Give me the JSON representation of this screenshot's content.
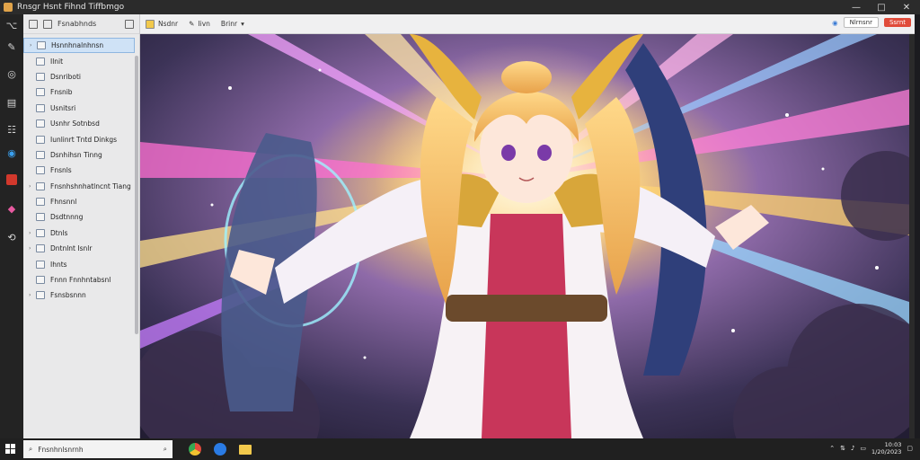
{
  "window": {
    "title": "Rnsgr Hsnt Fihnd Tiffbmgo",
    "controls": {
      "minimize": "—",
      "maximize": "□",
      "close": "✕"
    }
  },
  "rail": {
    "icons": [
      "code-icon",
      "pin-icon",
      "lens-icon",
      "doc-icon",
      "list-icon",
      "edge-icon",
      "app-red-icon",
      "paint-icon",
      "sync-icon"
    ]
  },
  "sidebar": {
    "toolbar_label": "Fsnabhnds",
    "items": [
      {
        "label": "Hsnnhnalnhnsn",
        "selected": true,
        "expandable": true
      },
      {
        "label": "Ilnit",
        "selected": false,
        "expandable": false
      },
      {
        "label": "Dsnriboti",
        "selected": false,
        "expandable": false
      },
      {
        "label": "Fnsnib",
        "selected": false,
        "expandable": false
      },
      {
        "label": "Usnitsri",
        "selected": false,
        "expandable": false
      },
      {
        "label": "Usnhr Sotnbsd",
        "selected": false,
        "expandable": false
      },
      {
        "label": "Iunlinrt Tntd Dinkgs",
        "selected": false,
        "expandable": false
      },
      {
        "label": "Dsnhihsn Tinng",
        "selected": false,
        "expandable": false
      },
      {
        "label": "Fnsnls",
        "selected": false,
        "expandable": false
      },
      {
        "label": "Fnsnhshnhatlncnt Tiang",
        "selected": false,
        "expandable": true
      },
      {
        "label": "Fhnsnnl",
        "selected": false,
        "expandable": false
      },
      {
        "label": "Dsdtnnng",
        "selected": false,
        "expandable": false
      },
      {
        "label": "Dtnls",
        "selected": false,
        "expandable": true
      },
      {
        "label": "Dntnlnt Isnlr",
        "selected": false,
        "expandable": true
      },
      {
        "label": "Ihnts",
        "selected": false,
        "expandable": false
      },
      {
        "label": "Fnnn Fnnhntabsnl",
        "selected": false,
        "expandable": false
      },
      {
        "label": "Fsnsbsnnn",
        "selected": false,
        "expandable": true
      }
    ]
  },
  "canvas_toolbar": {
    "buttons": [
      "Nsdnr",
      "Iivn",
      "Brinr"
    ],
    "zoom_label": "Nlrnsnr",
    "action_label": "Ssrnt"
  },
  "taskbar": {
    "search_placeholder": "Fnsnhnlsnrnh",
    "clock_time": "10:03",
    "clock_date": "1/20/2023"
  },
  "colors": {
    "accent": "#3a7bd5",
    "selection": "#cfe2f6",
    "danger": "#e04b3a"
  }
}
